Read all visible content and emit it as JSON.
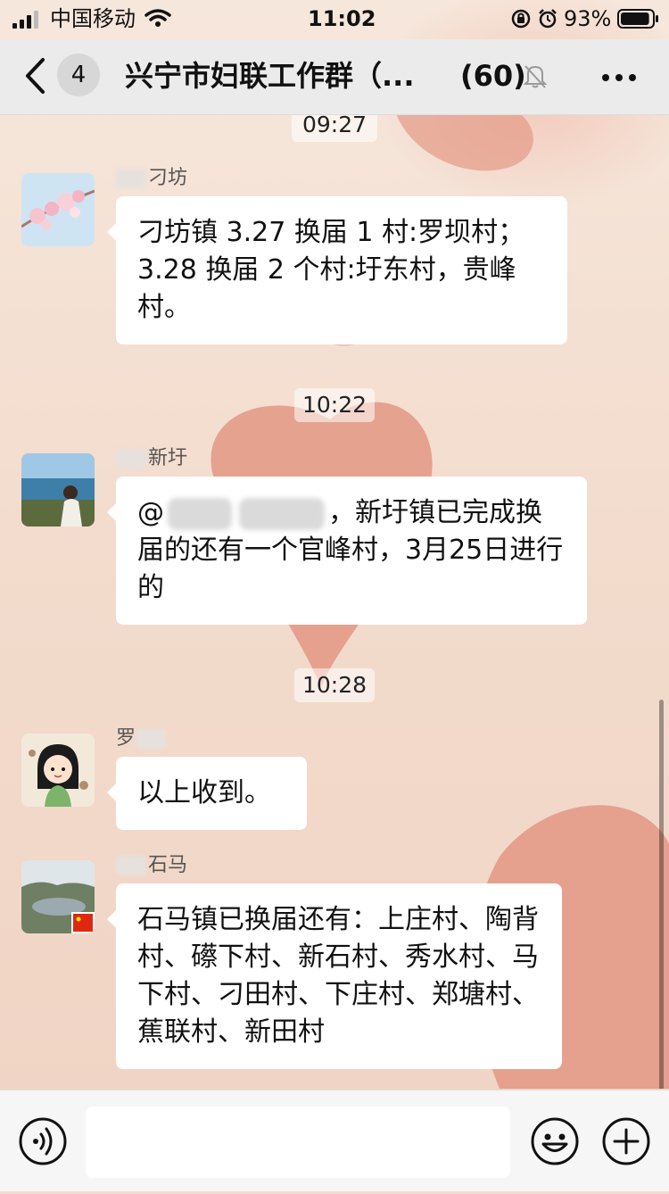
{
  "status_bar": {
    "carrier": "中国移动",
    "time": "11:02",
    "battery": "93%",
    "battery_level": 0.93
  },
  "nav": {
    "unread": "4",
    "title": "兴宁市妇联工作群（...",
    "count": "(60)"
  },
  "messages": [
    {
      "timestamp": "09:27",
      "sender": "刁坊",
      "text": "刁坊镇 3.27 换届 1 村:罗坝村；3.28 换届 2 个村:圩东村，贵峰村。",
      "avatar_icon": "cherry-blossom-avatar"
    },
    {
      "timestamp": "10:22",
      "sender": "新圩",
      "text_prefix": "@",
      "text": "，新圩镇已完成换届的还有一个官峰村，3月25日进行的",
      "avatar_icon": "seaside-photo-avatar"
    },
    {
      "timestamp": "10:28",
      "sender": "罗",
      "text": "以上收到。",
      "avatar_icon": "cartoon-girl-avatar"
    },
    {
      "sender": "石马",
      "text": "石马镇已换届还有：上庄村、陶背村、礤下村、新石村、秀水村、马下村、刁田村、下庄村、郑塘村、蕉联村、新田村",
      "avatar_icon": "lake-landscape-avatar"
    }
  ],
  "input": {
    "placeholder": ""
  },
  "colors": {
    "background": "#f3dccd",
    "bubble": "#ffffff",
    "nav_bg": "#ebebeb"
  }
}
